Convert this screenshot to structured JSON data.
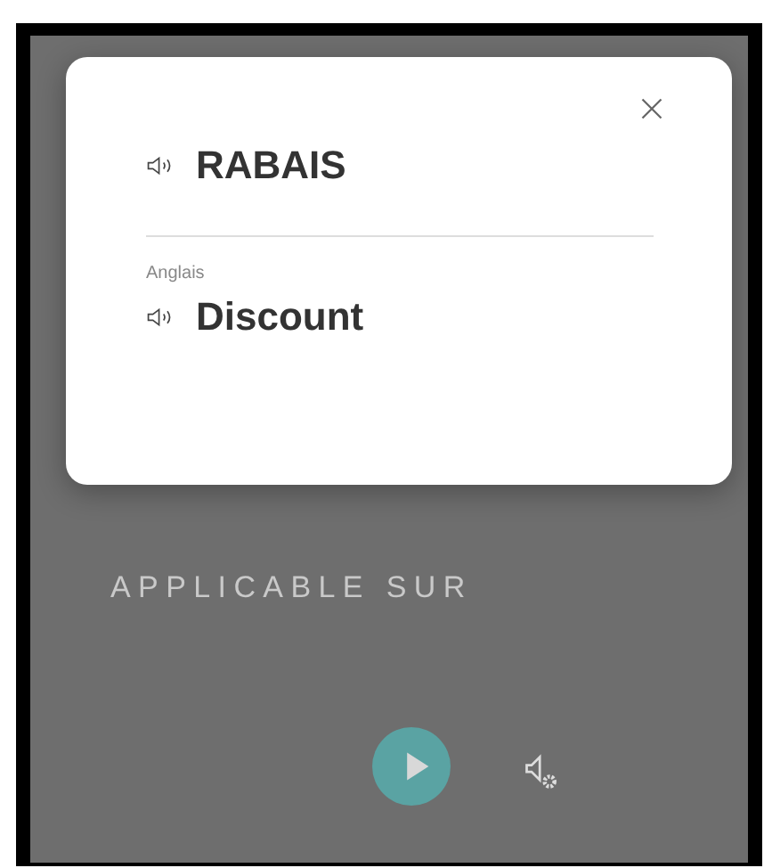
{
  "background": {
    "heading": "APPLICABLE SUR"
  },
  "popup": {
    "term": "RABAIS",
    "translation_language": "Anglais",
    "translation": "Discount"
  },
  "player": {
    "playing": false
  }
}
